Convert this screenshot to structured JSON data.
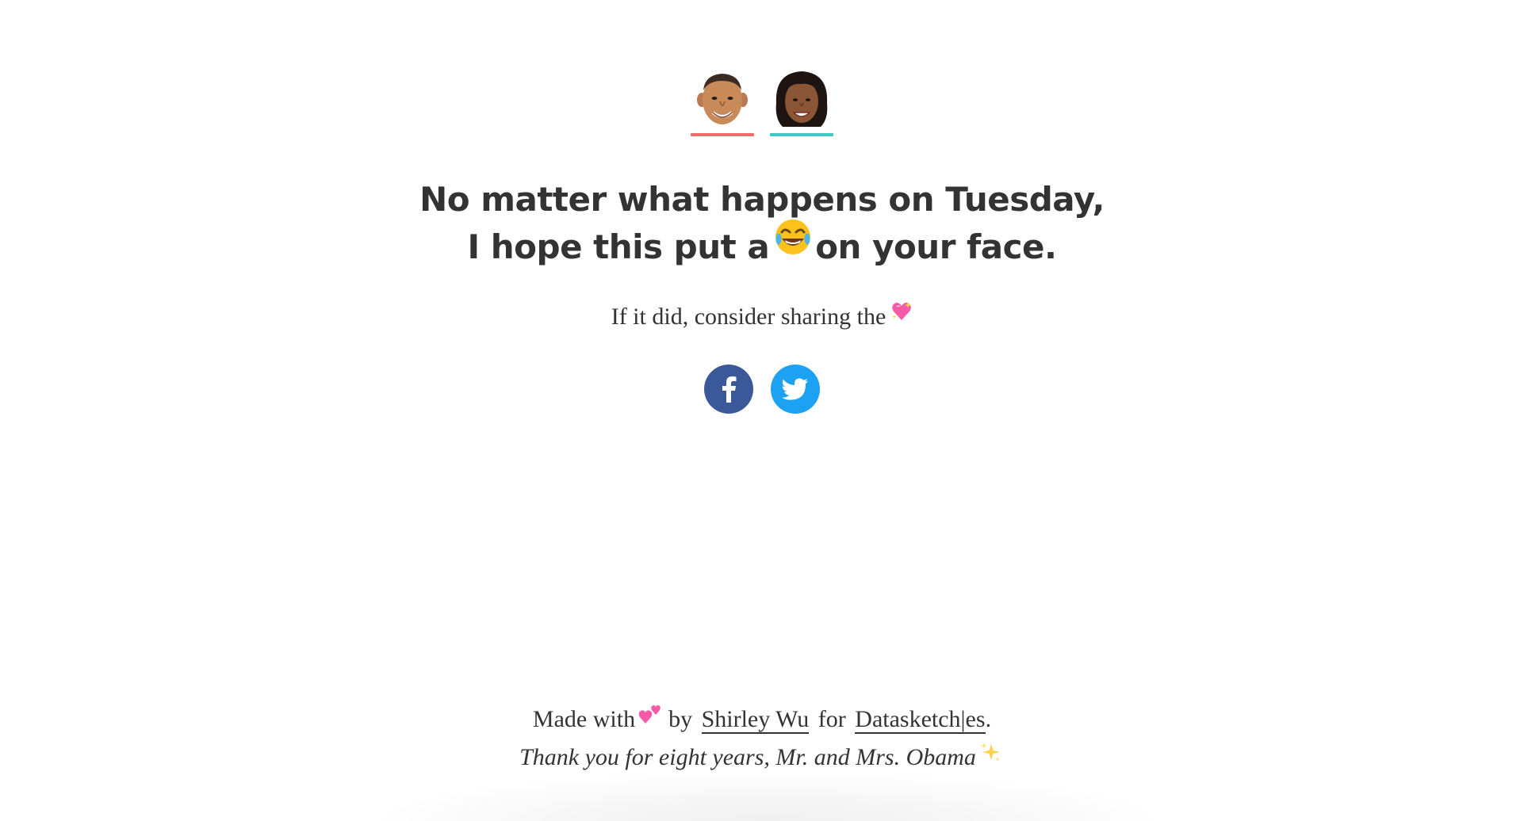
{
  "faces": [
    {
      "name": "barack",
      "underline_color": "#f26b6b"
    },
    {
      "name": "michelle",
      "underline_color": "#3ec9c0"
    }
  ],
  "headline": {
    "line1": "No matter what happens on Tuesday,",
    "line2_before": "I hope this put a",
    "line2_emoji": "face-with-tears-of-joy-icon",
    "line2_after": "on your face."
  },
  "share": {
    "text": "If it did, consider sharing the",
    "emoji": "sparkling-heart-icon"
  },
  "social": {
    "facebook_color": "#3b5998",
    "twitter_color": "#1da1f2"
  },
  "footer": {
    "made_with": "Made with",
    "by": "by",
    "author_link": "Shirley Wu",
    "for": "for",
    "site_link": "Datasketch|es",
    "period": ".",
    "thanks": "Thank you for eight years, Mr. and Mrs. Obama"
  }
}
